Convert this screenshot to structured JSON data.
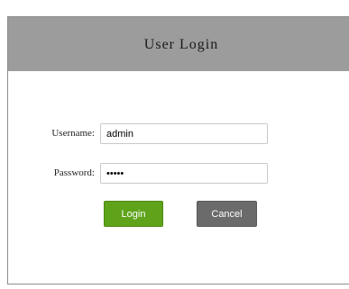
{
  "login": {
    "title": "User Login",
    "username_label": "Username:",
    "username_value": "admin",
    "password_label": "Password:",
    "password_value": "admin",
    "login_label": "Login",
    "cancel_label": "Cancel"
  },
  "colors": {
    "header": "#9c9c9c",
    "login_button": "#5ea31a",
    "cancel_button": "#6b6b6b"
  }
}
